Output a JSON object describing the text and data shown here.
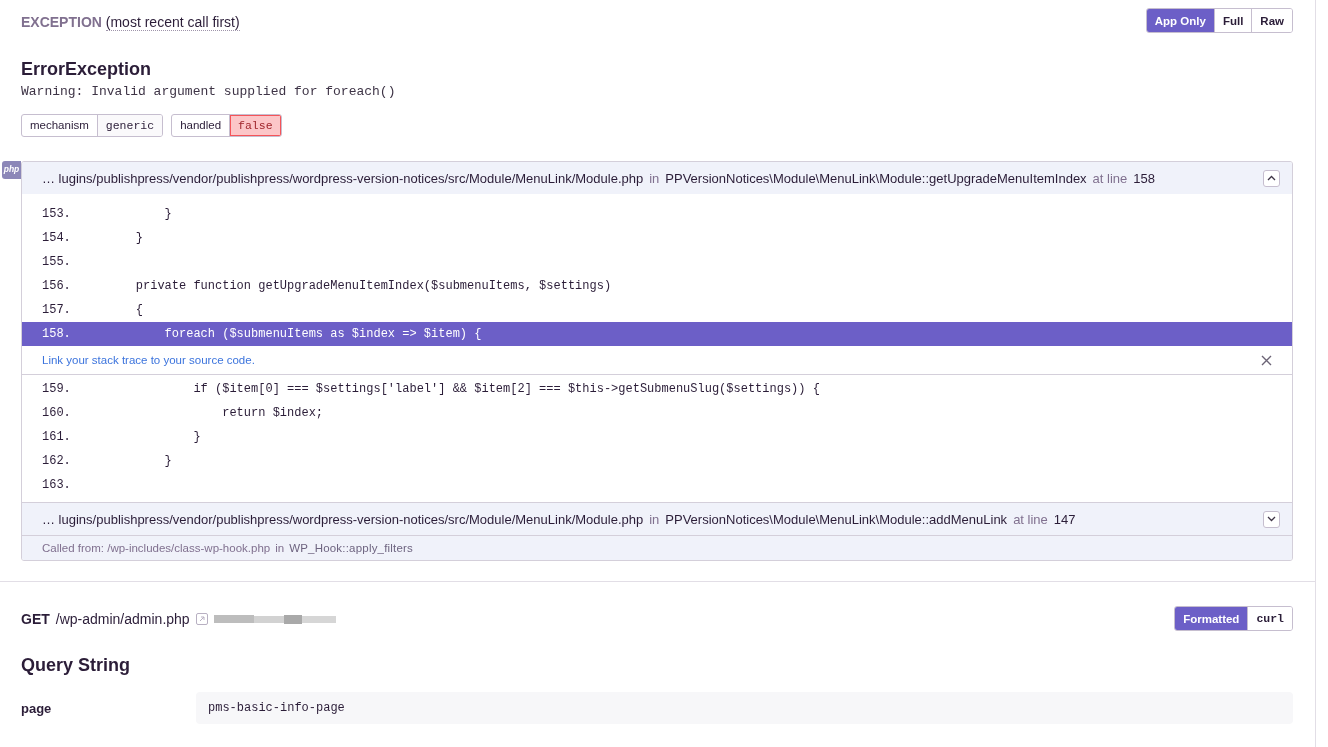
{
  "exception_header": {
    "label": "EXCEPTION",
    "hint": "(most recent call first)"
  },
  "view_toggle": [
    {
      "label": "App Only",
      "selected": true
    },
    {
      "label": "Full",
      "selected": false
    },
    {
      "label": "Raw",
      "selected": false
    }
  ],
  "exception": {
    "type": "ErrorException",
    "message": "Warning: Invalid argument supplied for foreach()"
  },
  "tags": [
    {
      "key": "mechanism",
      "value": "generic",
      "alert": false
    },
    {
      "key": "handled",
      "value": "false",
      "alert": true
    }
  ],
  "platform_badge": "php",
  "frames": [
    {
      "path": "… lugins/publishpress/vendor/publishpress/wordpress-version-notices/src/Module/MenuLink/Module.php",
      "in": "in",
      "function": "PPVersionNotices\\Module\\MenuLink\\Module::getUpgradeMenuItemIndex",
      "at": "at line",
      "line": "158",
      "expanded": true,
      "lines": [
        {
          "number": "153.",
          "code": "        }",
          "highlighted": false
        },
        {
          "number": "154.",
          "code": "    }",
          "highlighted": false
        },
        {
          "number": "155.",
          "highlighted": false
        },
        {
          "number": "156.",
          "code": "    private function getUpgradeMenuItemIndex($submenuItems, $settings)",
          "highlighted": false
        },
        {
          "number": "157.",
          "code": "    {",
          "highlighted": false
        },
        {
          "number": "158.",
          "code": "        foreach ($submenuItems as $index => $item) {",
          "highlighted": true
        },
        {
          "number": "159.",
          "code": "            if ($item[0] === $settings['label'] && $item[2] === $this->getSubmenuSlug($settings)) {",
          "highlighted": false
        },
        {
          "number": "160.",
          "code": "                return $index;",
          "highlighted": false
        },
        {
          "number": "161.",
          "code": "            }",
          "highlighted": false
        },
        {
          "number": "162.",
          "code": "        }",
          "highlighted": false
        },
        {
          "number": "163.",
          "highlighted": false
        }
      ],
      "banner": "Link your stack trace to your source code."
    },
    {
      "path": "… lugins/publishpress/vendor/publishpress/wordpress-version-notices/src/Module/MenuLink/Module.php",
      "in": "in",
      "function": "PPVersionNotices\\Module\\MenuLink\\Module::addMenuLink",
      "at": "at line",
      "line": "147",
      "expanded": false,
      "called_from": {
        "label": "Called from: /wp-includes/class-wp-hook.php",
        "in": "in",
        "function": "WP_Hook::apply_filters"
      }
    }
  ],
  "request": {
    "method": "GET",
    "url": "/wp-admin/admin.php",
    "formats": [
      {
        "label": "Formatted",
        "selected": true
      },
      {
        "label": "curl",
        "selected": false
      }
    ]
  },
  "query_string": {
    "title": "Query String",
    "rows": [
      {
        "key": "page",
        "value": "pms-basic-info-page"
      }
    ]
  }
}
